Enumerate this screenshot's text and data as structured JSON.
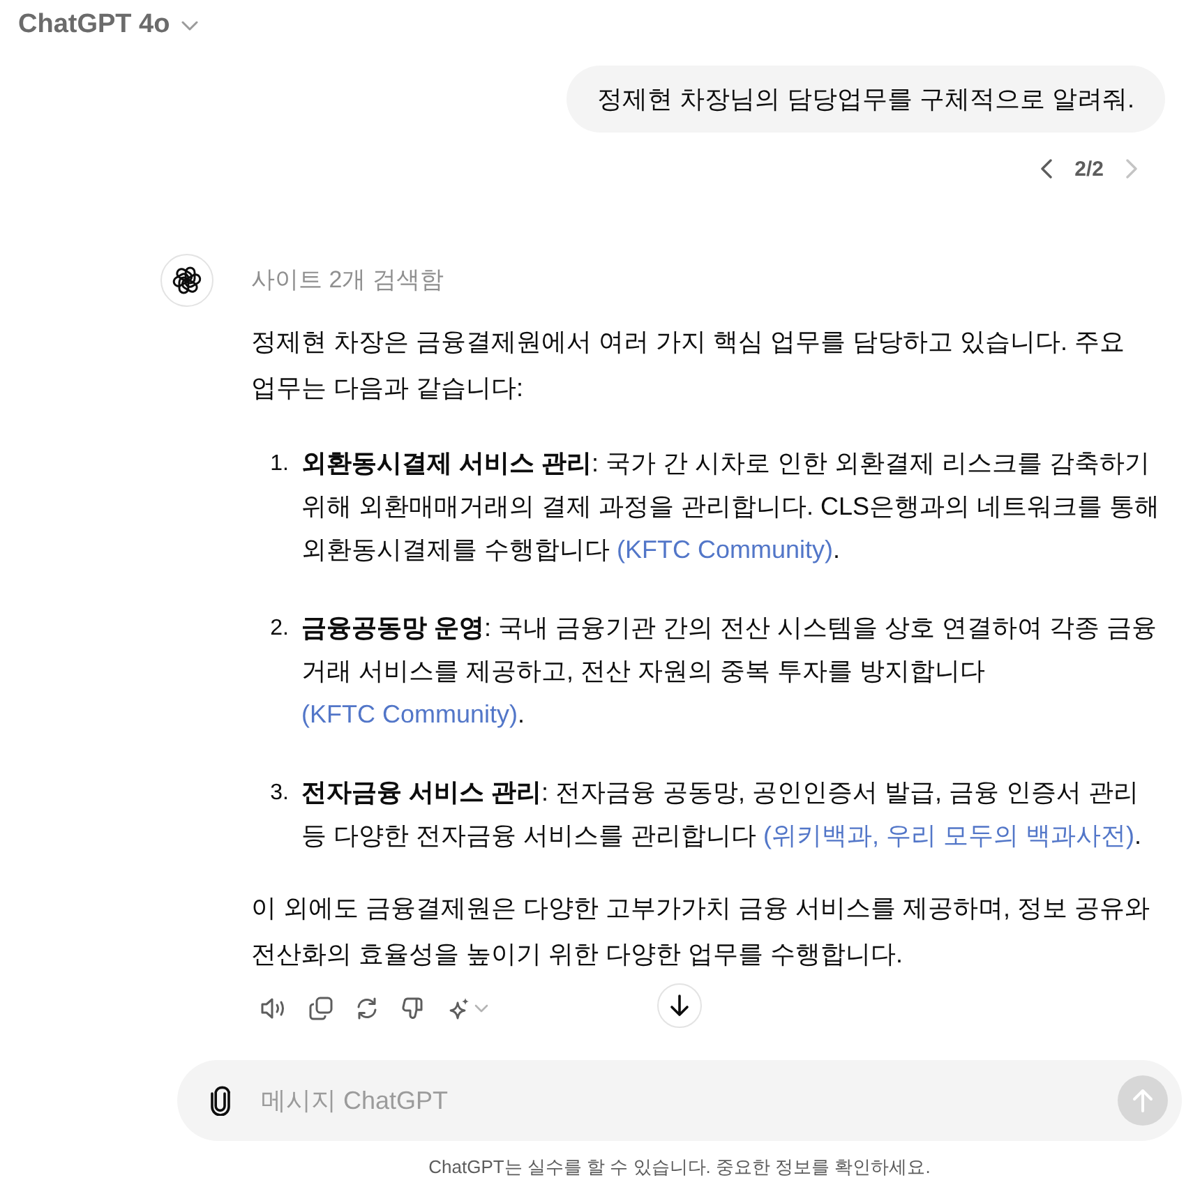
{
  "header": {
    "model_name": "ChatGPT 4o"
  },
  "user_message": {
    "text": "정제현 차장님의 담당업무를 구체적으로 알려줘.",
    "pager": {
      "label": "2/2",
      "prev_disabled": false,
      "next_disabled": true
    }
  },
  "assistant_message": {
    "search_status": "사이트 2개 검색함",
    "intro": "정제현 차장은 금융결제원에서 여러 가지 핵심 업무를 담당하고 있습니다. 주요 업무는 다음과 같습니다:",
    "items": [
      {
        "number": "1.",
        "text": "**외환동시결제 서비스 관리**: 국가 간 시차로 인한 외환결제 리스크를 감축하기 위해 외환매매거래의 결제 과정을 관리합니다. CLS은행과의 네트워크를 통해 외환동시결제를 수행합니다",
        "source": "(KFTC Community)",
        "trailing_text": "."
      },
      {
        "number": "2.",
        "text": "**금융공동망 운영**: 국내 금융기관 간의 전산 시스템을 상호 연결하여 각종 금융 거래 서비스를 제공하고, 전산 자원의 중복 투자를 방지합니다",
        "source": "(KFTC Community)",
        "trailing_text": "."
      },
      {
        "number": "3.",
        "text": "**전자금융 서비스 관리**: 전자금융 공동망, 공인인증서 발급, 금융 인증서 관리 등 다양한 전자금융 서비스를 관리합니다",
        "source": "(위키백과, 우리 모두의 백과사전)",
        "trailing_text": "."
      }
    ],
    "closing": "이 외에도 금융결제원은 다양한 고부가가치 금융 서비스를 제공하며, 정보 공유와 전산화의 효율성을 높이기 위한 다양한 업무를 수행합니다."
  },
  "composer": {
    "placeholder": "메시지 ChatGPT",
    "send_disabled": true
  },
  "disclaimer": "ChatGPT는 실수를 할 수 있습니다. 중요한 정보를 확인하세요."
}
